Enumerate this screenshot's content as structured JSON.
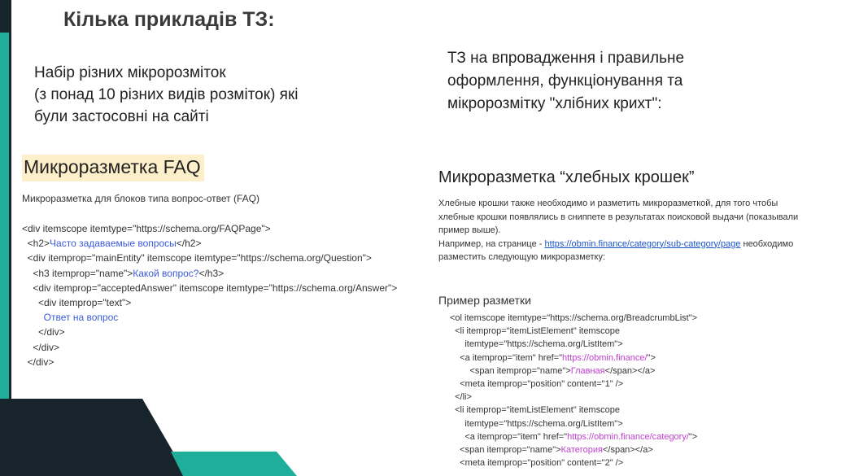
{
  "slide": {
    "title": "Кілька прикладів ТЗ:",
    "left_description": [
      "Набір різних мікророзміток",
      "(з понад 10 різних видів розміток) які",
      "були застосовні на сайті"
    ],
    "right_description": [
      "ТЗ на впровадження і правильне",
      "оформлення, функціонування та",
      "мікророзмітку \"хлібних крихт\":"
    ]
  },
  "faq_snippet": {
    "heading": "Микроразметка FAQ",
    "subtitle": "Микроразметка для блоков типа вопрос-ответ (FAQ)",
    "code": [
      {
        "pre": "<div itemscope itemtype=\"https://schema.org/FAQPage\">",
        "hl": "",
        "post": ""
      },
      {
        "pre": "  <h2>",
        "hl": "Часто задаваемые вопросы",
        "post": "</h2>"
      },
      {
        "pre": "  <div itemprop=\"mainEntity\" itemscope itemtype=\"https://schema.org/Question\">",
        "hl": "",
        "post": ""
      },
      {
        "pre": "    <h3 itemprop=\"name\">",
        "hl": "Какой вопрос?",
        "post": "</h3>"
      },
      {
        "pre": "    <div itemprop=\"acceptedAnswer\" itemscope itemtype=\"https://schema.org/Answer\">",
        "hl": "",
        "post": ""
      },
      {
        "pre": "      <div itemprop=\"text\">",
        "hl": "",
        "post": ""
      },
      {
        "pre": "        ",
        "hl": "Ответ на вопрос",
        "post": ""
      },
      {
        "pre": "      </div>",
        "hl": "",
        "post": ""
      },
      {
        "pre": "    </div>",
        "hl": "",
        "post": ""
      },
      {
        "pre": "  </div>",
        "hl": "",
        "post": ""
      }
    ]
  },
  "breadcrumb_snippet": {
    "heading": "Микроразметка “хлебных крошек”",
    "paragraph_lines": [
      "Хлебные крошки также необходимо и разметить микроразметкой, для того чтобы",
      "хлебные крошки появлялись в сниппете в результатах поисковой выдачи (показывали",
      "пример выше)."
    ],
    "example_prefix": "Например, на странице - ",
    "example_link": "https://obmin.finance/category/sub-category/page",
    "example_suffix": " необходимо",
    "example_line2": "разместить следующую микроразметку:",
    "sample_title": "Пример разметки",
    "code": [
      {
        "pre": "<ol itemscope itemtype=\"https://schema.org/BreadcrumbList\">",
        "hl": "",
        "post": ""
      },
      {
        "pre": "  <li itemprop=\"itemListElement\" itemscope",
        "hl": "",
        "post": ""
      },
      {
        "pre": "      itemtype=\"https://schema.org/ListItem\">",
        "hl": "",
        "post": ""
      },
      {
        "pre": "    <a itemprop=\"item\" href=\"",
        "hl": "https://obmin.finance/",
        "post": "\">"
      },
      {
        "pre": "        <span itemprop=\"name\">",
        "hl": "Главная",
        "post": "</span></a>"
      },
      {
        "pre": "    <meta itemprop=\"position\" content=\"1\" />",
        "hl": "",
        "post": ""
      },
      {
        "pre": "  </li>",
        "hl": "",
        "post": ""
      },
      {
        "pre": "  <li itemprop=\"itemListElement\" itemscope",
        "hl": "",
        "post": ""
      },
      {
        "pre": "      itemtype=\"https://schema.org/ListItem\">",
        "hl": "",
        "post": ""
      },
      {
        "pre": "      <a itemprop=\"item\" href=\"",
        "hl": "https://obmin.finance/category/",
        "post": "\">"
      },
      {
        "pre": "    <span itemprop=\"name\">",
        "hl": "Категория",
        "post": "</span></a>"
      },
      {
        "pre": "    <meta itemprop=\"position\" content=\"2\" />",
        "hl": "",
        "post": ""
      }
    ]
  },
  "colors": {
    "teal_accent": "#1fae9a",
    "dark_accent": "#17242b",
    "highlight_bg": "#fdefc9",
    "code_blue": "#3b5bdb",
    "code_magenta": "#c13fd1",
    "link_blue": "#1a55c8"
  }
}
